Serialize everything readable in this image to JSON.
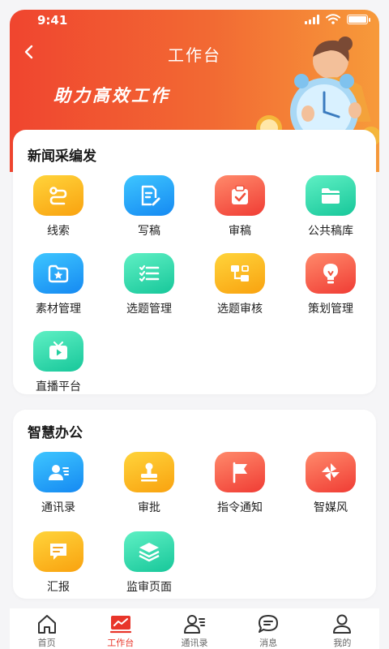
{
  "status": {
    "time": "9:41"
  },
  "header": {
    "title": "工作台",
    "slogan": "助力高效工作"
  },
  "news_section": {
    "title": "新闻采编发",
    "items": [
      {
        "label": "线索",
        "icon": "link-icon",
        "color": "yellow"
      },
      {
        "label": "写稿",
        "icon": "edit-document-icon",
        "color": "blue"
      },
      {
        "label": "审稿",
        "icon": "clipboard-check-icon",
        "color": "red"
      },
      {
        "label": "公共稿库",
        "icon": "folder-icon",
        "color": "green"
      },
      {
        "label": "素材管理",
        "icon": "star-folder-icon",
        "color": "blue"
      },
      {
        "label": "选题管理",
        "icon": "checklist-icon",
        "color": "green"
      },
      {
        "label": "选题审核",
        "icon": "flowchart-icon",
        "color": "yellow"
      },
      {
        "label": "策划管理",
        "icon": "lightbulb-icon",
        "color": "red"
      },
      {
        "label": "直播平台",
        "icon": "tv-play-icon",
        "color": "green"
      }
    ]
  },
  "office_section": {
    "title": "智慧办公",
    "items": [
      {
        "label": "通讯录",
        "icon": "contact-card-icon",
        "color": "blue"
      },
      {
        "label": "审批",
        "icon": "stamp-icon",
        "color": "yellow"
      },
      {
        "label": "指令通知",
        "icon": "flag-icon",
        "color": "red"
      },
      {
        "label": "智媒风",
        "icon": "pinwheel-icon",
        "color": "red"
      },
      {
        "label": "汇报",
        "icon": "report-icon",
        "color": "yellow"
      },
      {
        "label": "监审页面",
        "icon": "layers-icon",
        "color": "green"
      }
    ]
  },
  "tabbar": {
    "items": [
      {
        "label": "首页",
        "icon": "home-icon",
        "active": false
      },
      {
        "label": "工作台",
        "icon": "chart-icon",
        "active": true
      },
      {
        "label": "通讯录",
        "icon": "contacts-icon",
        "active": false
      },
      {
        "label": "消息",
        "icon": "message-icon",
        "active": false
      },
      {
        "label": "我的",
        "icon": "user-icon",
        "active": false
      }
    ]
  },
  "colors": {
    "accent": "#e8352a",
    "header_start": "#f0452f",
    "header_end": "#f79a3a"
  }
}
